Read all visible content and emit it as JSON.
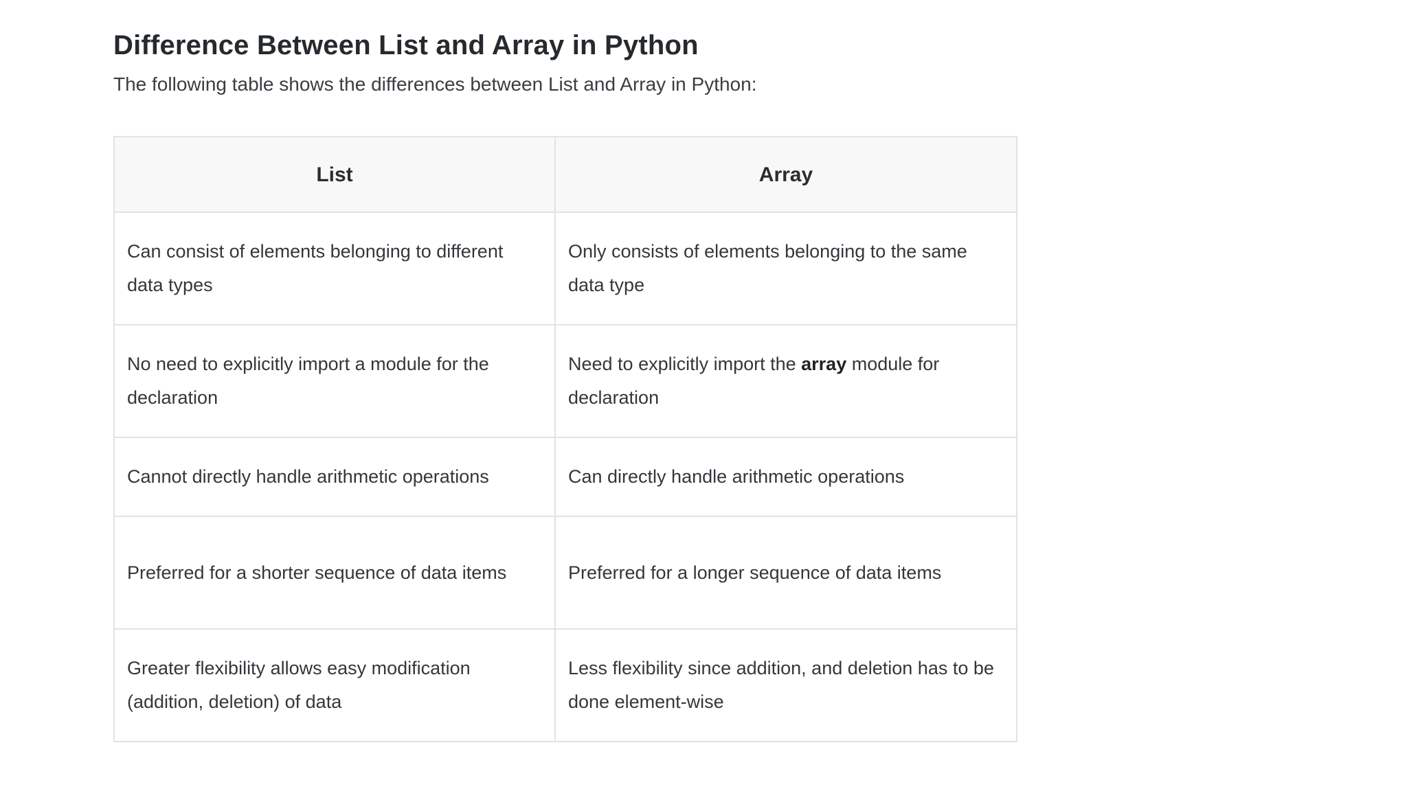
{
  "heading": "Difference Between List and Array in Python",
  "intro": "The following table shows the differences between List and Array in Python:",
  "table": {
    "headers": [
      "List",
      "Array"
    ],
    "rows": [
      {
        "list": "Can consist of elements belonging to different data types",
        "array": "Only consists of elements belonging to the same data type"
      },
      {
        "list": "No need to explicitly import a module for the declaration",
        "array_pre": "Need to explicitly import the ",
        "array_bold": "array",
        "array_post": " module for declaration"
      },
      {
        "list": "Cannot directly handle arithmetic operations",
        "array": "Can directly handle arithmetic operations"
      },
      {
        "list": "Preferred for a shorter sequence of data items",
        "array": "Preferred for a longer sequence of data items"
      },
      {
        "list": "Greater flexibility allows easy modification (addition, deletion) of data",
        "array": "Less flexibility since addition, and deletion has to be done element-wise"
      }
    ]
  }
}
